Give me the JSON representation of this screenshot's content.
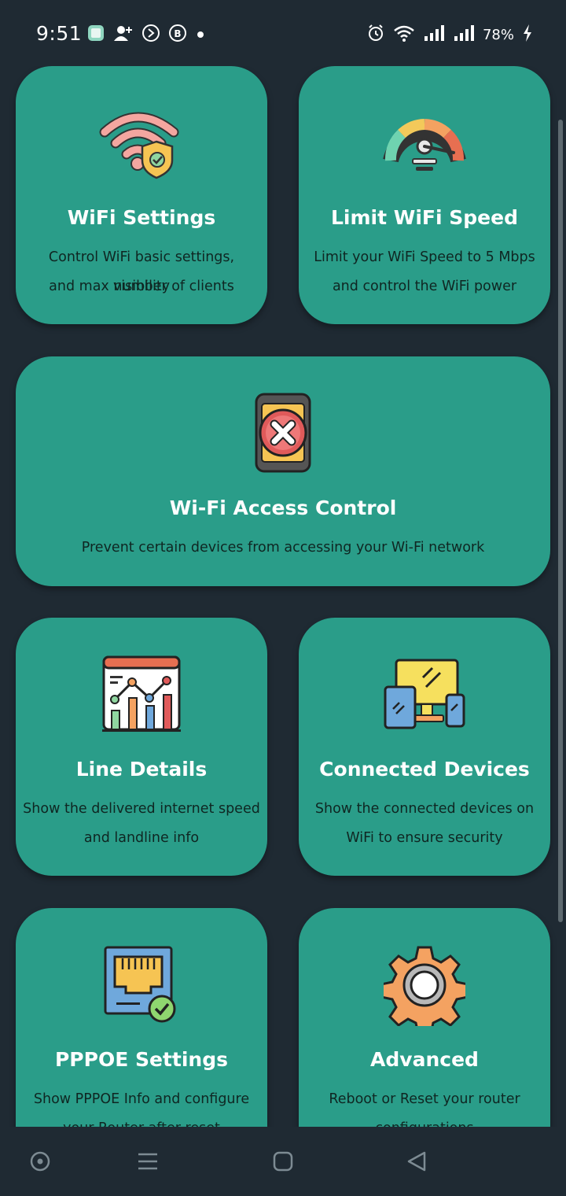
{
  "status_bar": {
    "time": "9:51",
    "battery_percent": "78%",
    "left_icons": [
      "app-icon",
      "add-contact-icon",
      "sync-icon",
      "business-icon",
      "dot-icon"
    ],
    "right_icons": [
      "alarm-icon",
      "wifi-icon",
      "signal-icon",
      "signal-icon",
      "charging-icon"
    ]
  },
  "cards": [
    {
      "id": "wifi-settings",
      "title": "WiFi Settings",
      "desc1": "Control WiFi basic settings, visibility",
      "desc2": "and max number of clients",
      "icon": "wifi-shield-icon"
    },
    {
      "id": "limit-wifi-speed",
      "title": "Limit WiFi Speed",
      "desc1": "Limit your WiFi Speed to 5 Mbps",
      "desc2": "and control the WiFi power",
      "icon": "speedometer-icon"
    },
    {
      "id": "wifi-access-control",
      "title": "Wi-Fi Access Control",
      "desc1": "Prevent certain devices from accessing your Wi-Fi network",
      "desc2": "",
      "icon": "blocked-phone-icon"
    },
    {
      "id": "line-details",
      "title": "Line Details",
      "desc1": "Show the delivered internet speed",
      "desc2": "and landline info",
      "icon": "chart-icon"
    },
    {
      "id": "connected-devices",
      "title": "Connected Devices",
      "desc1": "Show the connected devices on",
      "desc2": "WiFi to ensure security",
      "icon": "devices-icon"
    },
    {
      "id": "pppoe-settings",
      "title": "PPPOE Settings",
      "desc1": "Show PPPOE Info and configure",
      "desc2": "your Router after reset",
      "icon": "ethernet-port-icon"
    },
    {
      "id": "advanced",
      "title": "Advanced",
      "desc1": "Reboot or Reset your router",
      "desc2": "configurations",
      "icon": "gear-icon"
    }
  ],
  "colors": {
    "background": "#1f2a33",
    "card": "#2a9d89",
    "desc_text": "#0f2622"
  },
  "nav_bar": {
    "buttons": [
      "assistant-icon",
      "recents-icon",
      "home-icon",
      "back-icon"
    ]
  }
}
